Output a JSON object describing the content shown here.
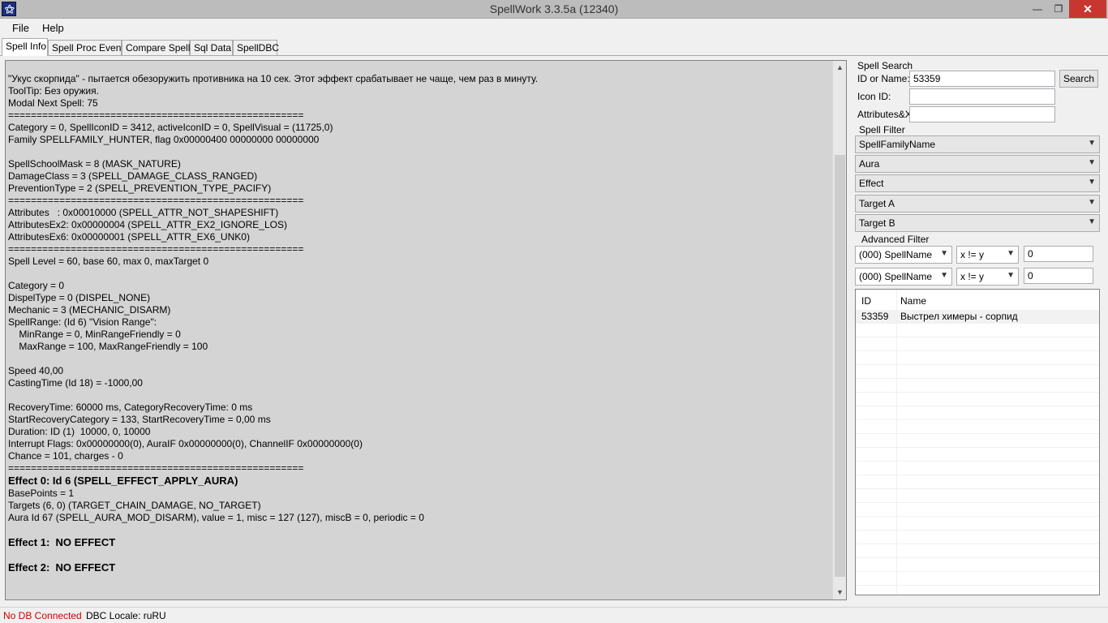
{
  "window": {
    "title": "SpellWork 3.3.5a (12340)",
    "min_glyph": "—",
    "max_glyph": "❐",
    "close_glyph": "✕"
  },
  "menu": {
    "file": "File",
    "help": "Help"
  },
  "tabs": [
    {
      "label": "Spell Info",
      "active": true
    },
    {
      "label": "Spell Proc Event",
      "active": false
    },
    {
      "label": "Compare Spells",
      "active": false
    },
    {
      "label": "Sql Data",
      "active": false
    },
    {
      "label": "SpellDBC",
      "active": false
    }
  ],
  "spell_info": {
    "lines": [
      {
        "text": "\"Укус скорпида\" - пытается обезоружить противника на 10 сек. Этот эффект срабатывает не чаще, чем раз в минуту.",
        "bold": false
      },
      {
        "text": "ToolTip: Без оружия.",
        "bold": false
      },
      {
        "text": "Modal Next Spell: 75",
        "bold": false
      },
      {
        "text": "====================================================",
        "bold": false
      },
      {
        "text": "Category = 0, SpellIconID = 3412, activeIconID = 0, SpellVisual = (11725,0)",
        "bold": false
      },
      {
        "text": "Family SPELLFAMILY_HUNTER, flag 0x00000400 00000000 00000000",
        "bold": false
      },
      {
        "text": "",
        "bold": false
      },
      {
        "text": "SpellSchoolMask = 8 (MASK_NATURE)",
        "bold": false
      },
      {
        "text": "DamageClass = 3 (SPELL_DAMAGE_CLASS_RANGED)",
        "bold": false
      },
      {
        "text": "PreventionType = 2 (SPELL_PREVENTION_TYPE_PACIFY)",
        "bold": false
      },
      {
        "text": "====================================================",
        "bold": false
      },
      {
        "text": "Attributes   : 0x00010000 (SPELL_ATTR_NOT_SHAPESHIFT)",
        "bold": false
      },
      {
        "text": "AttributesEx2: 0x00000004 (SPELL_ATTR_EX2_IGNORE_LOS)",
        "bold": false
      },
      {
        "text": "AttributesEx6: 0x00000001 (SPELL_ATTR_EX6_UNK0)",
        "bold": false
      },
      {
        "text": "====================================================",
        "bold": false
      },
      {
        "text": "Spell Level = 60, base 60, max 0, maxTarget 0",
        "bold": false
      },
      {
        "text": "",
        "bold": false
      },
      {
        "text": "Category = 0",
        "bold": false
      },
      {
        "text": "DispelType = 0 (DISPEL_NONE)",
        "bold": false
      },
      {
        "text": "Mechanic = 3 (MECHANIC_DISARM)",
        "bold": false
      },
      {
        "text": "SpellRange: (Id 6) \"Vision Range\":",
        "bold": false
      },
      {
        "text": "    MinRange = 0, MinRangeFriendly = 0",
        "bold": false
      },
      {
        "text": "    MaxRange = 100, MaxRangeFriendly = 100",
        "bold": false
      },
      {
        "text": "",
        "bold": false
      },
      {
        "text": "Speed 40,00",
        "bold": false
      },
      {
        "text": "CastingTime (Id 18) = -1000,00",
        "bold": false
      },
      {
        "text": "",
        "bold": false
      },
      {
        "text": "RecoveryTime: 60000 ms, CategoryRecoveryTime: 0 ms",
        "bold": false
      },
      {
        "text": "StartRecoveryCategory = 133, StartRecoveryTime = 0,00 ms",
        "bold": false
      },
      {
        "text": "Duration: ID (1)  10000, 0, 10000",
        "bold": false
      },
      {
        "text": "Interrupt Flags: 0x00000000(0), AuraIF 0x00000000(0), ChannelIF 0x00000000(0)",
        "bold": false
      },
      {
        "text": "Chance = 101, charges - 0",
        "bold": false
      },
      {
        "text": "====================================================",
        "bold": false
      },
      {
        "text": "Effect 0: Id 6 (SPELL_EFFECT_APPLY_AURA)",
        "bold": true
      },
      {
        "text": "BasePoints = 1",
        "bold": false
      },
      {
        "text": "Targets (6, 0) (TARGET_CHAIN_DAMAGE, NO_TARGET)",
        "bold": false
      },
      {
        "text": "Aura Id 67 (SPELL_AURA_MOD_DISARM), value = 1, misc = 127 (127), miscB = 0, periodic = 0",
        "bold": false
      },
      {
        "text": "",
        "bold": false
      },
      {
        "text": "Effect 1:  NO EFFECT",
        "bold": true
      },
      {
        "text": "",
        "bold": false
      },
      {
        "text": "Effect 2:  NO EFFECT",
        "bold": true
      }
    ]
  },
  "spell_search": {
    "group_label": "Spell Search",
    "id_label": "ID or Name:",
    "id_value": "53359",
    "icon_label": "Icon ID:",
    "icon_value": "",
    "attr_label": "Attributes&X:",
    "attr_value": "",
    "search_button": "Search"
  },
  "spell_filter": {
    "group_label": "Spell Filter",
    "family": "SpellFamilyName",
    "aura": "Aura",
    "effect": "Effect",
    "target_a": "Target A",
    "target_b": "Target B"
  },
  "advanced_filter": {
    "group_label": "Advanced Filter",
    "rows": [
      {
        "field": "(000) SpellName",
        "op": "x != y",
        "value": "0"
      },
      {
        "field": "(000) SpellName",
        "op": "x != y",
        "value": "0"
      }
    ]
  },
  "results": {
    "headers": {
      "id": "ID",
      "name": "Name"
    },
    "rows": [
      {
        "id": "53359",
        "name": "Выстрел химеры - сорпид"
      }
    ]
  },
  "status": {
    "db": "No DB Connected",
    "locale": "DBC Locale: ruRU"
  },
  "colors": {
    "status_error": "#d00000",
    "close_button": "#c7372f"
  }
}
